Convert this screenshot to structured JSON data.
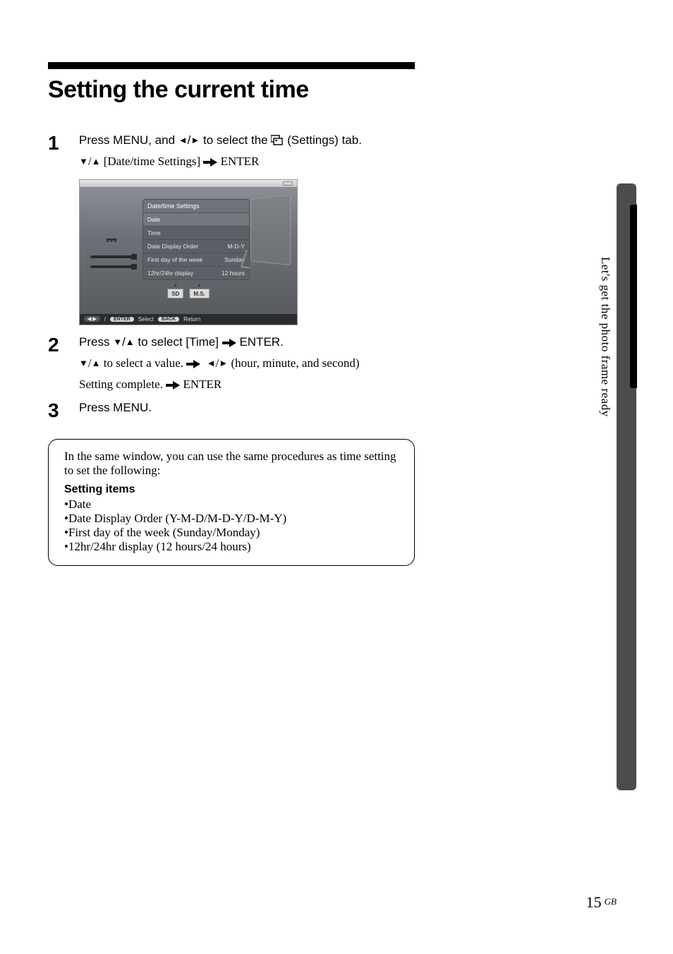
{
  "title": "Setting the current time",
  "side_tab_label": "Let's get the photo frame ready",
  "footer": {
    "page": "15",
    "region": "GB"
  },
  "steps": {
    "s1": {
      "num": "1",
      "lead_a": "Press MENU, and ",
      "lead_b": " to select the ",
      "lead_c": " (Settings) tab.",
      "sub_a": " [Date/time Settings] ",
      "sub_b": "  ENTER"
    },
    "s2": {
      "num": "2",
      "lead_a": "Press ",
      "lead_b": " to select [Time] ",
      "lead_c": "  ENTER.",
      "sub1_a": " to select a value. ",
      "sub1_b": " (hour, minute, and second)",
      "sub2_a": "Setting complete. ",
      "sub2_b": "  ENTER"
    },
    "s3": {
      "num": "3",
      "lead": "Press MENU."
    }
  },
  "glyphs": {
    "left": "◄",
    "right": "►",
    "down": "▼",
    "up": "▲",
    "slash": "/"
  },
  "screenshot": {
    "header": "Date/time Settings",
    "rows": [
      {
        "label": "Date",
        "value": ""
      },
      {
        "label": "Time",
        "value": ""
      },
      {
        "label": "Date Display Order",
        "value": "M-D-Y"
      },
      {
        "label": "First day of the week",
        "value": "Sunday"
      },
      {
        "label": "12hr/24hr display",
        "value": "12 hours"
      }
    ],
    "slots": {
      "sd": "SD",
      "ms": "M.S."
    },
    "hint": {
      "nav": "◀ ▶",
      "enter": "ENTER",
      "select": "Select",
      "back": "BACK",
      "return": "Return"
    }
  },
  "info": {
    "intro": "In the same window, you can use the same procedures as time setting to set the following:",
    "heading": "Setting items",
    "items": [
      "Date",
      "Date Display Order (Y-M-D/M-D-Y/D-M-Y)",
      "First day of the week (Sunday/Monday)",
      "12hr/24hr display (12 hours/24 hours)"
    ]
  }
}
